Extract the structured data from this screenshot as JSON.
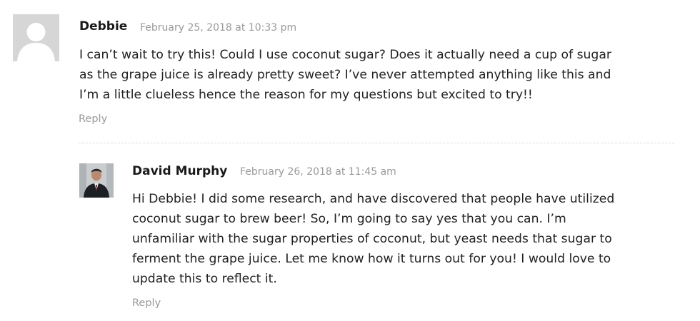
{
  "comments": [
    {
      "author": "Debbie",
      "date": "February 25, 2018 at 10:33 pm",
      "lines": [
        "I can’t wait to try this! Could I use coconut sugar? Does it actually need a cup of sugar",
        "as the grape juice is already pretty sweet? I’ve never attempted anything like this and",
        "I’m a little clueless hence the reason for my questions but excited to try!!"
      ],
      "reply_label": "Reply"
    },
    {
      "author": "David Murphy",
      "date": "February 26, 2018 at 11:45 am",
      "lines": [
        "Hi Debbie! I did some research, and have discovered that people have utilized",
        "coconut sugar to brew beer! So, I’m going to say yes that you can. I’m",
        "unfamiliar with the sugar properties of coconut, but yeast needs that sugar to",
        "ferment the grape juice. Let me know how it turns out for you! I would love to",
        "update this to reflect it."
      ],
      "reply_label": "Reply"
    }
  ]
}
